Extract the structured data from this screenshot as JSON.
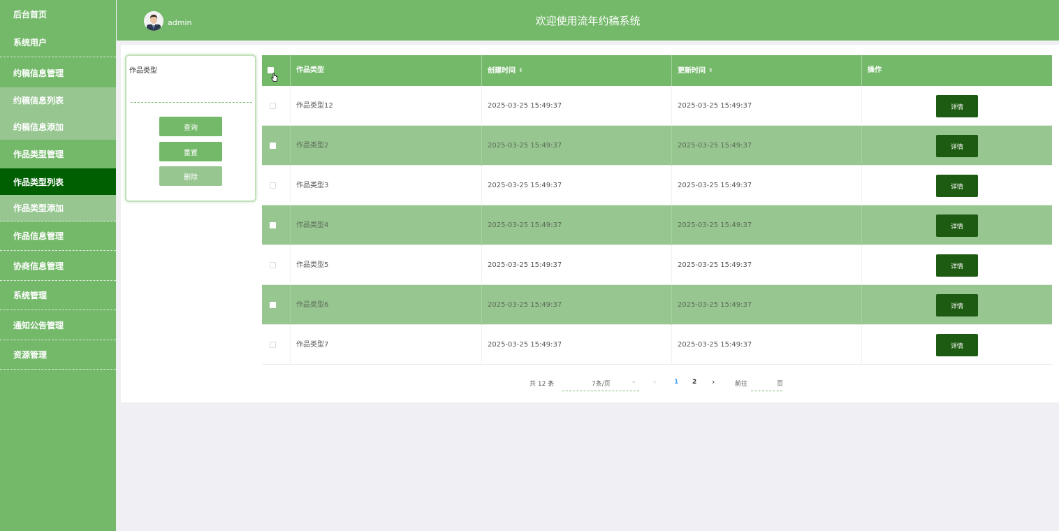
{
  "sidebar": {
    "items": [
      {
        "label": "后台首页"
      },
      {
        "label": "系统用户"
      },
      {
        "label": "约稿信息管理"
      },
      {
        "label": "约稿信息列表"
      },
      {
        "label": "约稿信息添加"
      },
      {
        "label": "作品类型管理"
      },
      {
        "label": "作品类型列表"
      },
      {
        "label": "作品类型添加"
      },
      {
        "label": "作品信息管理"
      },
      {
        "label": "协商信息管理"
      },
      {
        "label": "系统管理"
      },
      {
        "label": "通知公告管理"
      },
      {
        "label": "资源管理"
      }
    ]
  },
  "header": {
    "username": "admin",
    "title": "欢迎使用流年约稿系统"
  },
  "search": {
    "label": "作品类型",
    "value": "",
    "query_label": "查询",
    "reset_label": "重置",
    "delete_label": "删除"
  },
  "table": {
    "headers": {
      "type": "作品类型",
      "created": "创建时间",
      "updated": "更新时间",
      "action": "操作"
    },
    "detail_label": "详情",
    "rows": [
      {
        "type": "作品类型12",
        "created": "2025-03-25 15:49:37",
        "updated": "2025-03-25 15:49:37"
      },
      {
        "type": "作品类型2",
        "created": "2025-03-25 15:49:37",
        "updated": "2025-03-25 15:49:37"
      },
      {
        "type": "作品类型3",
        "created": "2025-03-25 15:49:37",
        "updated": "2025-03-25 15:49:37"
      },
      {
        "type": "作品类型4",
        "created": "2025-03-25 15:49:37",
        "updated": "2025-03-25 15:49:37"
      },
      {
        "type": "作品类型5",
        "created": "2025-03-25 15:49:37",
        "updated": "2025-03-25 15:49:37"
      },
      {
        "type": "作品类型6",
        "created": "2025-03-25 15:49:37",
        "updated": "2025-03-25 15:49:37"
      },
      {
        "type": "作品类型7",
        "created": "2025-03-25 15:49:37",
        "updated": "2025-03-25 15:49:37"
      }
    ]
  },
  "pagination": {
    "total_text": "共 12 条",
    "page_size": "7条/页",
    "pages": [
      "1",
      "2"
    ],
    "current_page": "1",
    "goto_label": "前往",
    "page_unit": "页"
  },
  "colors": {
    "primary": "#74b96a",
    "light": "#97c691",
    "active": "#005f00",
    "button_dark": "#1e5b12"
  },
  "icons": [
    "user-avatar",
    "sort-caret-icon",
    "chevron-down-icon",
    "chevron-left-icon",
    "chevron-right-icon",
    "pointer-cursor-icon"
  ]
}
